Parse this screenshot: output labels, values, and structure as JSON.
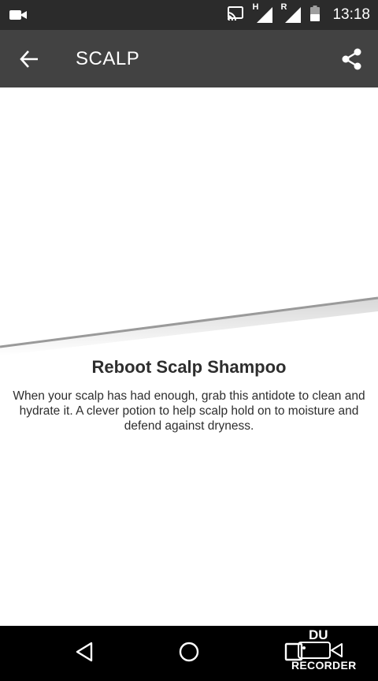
{
  "status_bar": {
    "time": "13:18",
    "network_h": "H",
    "network_r": "R"
  },
  "app_bar": {
    "title": "SCALP"
  },
  "product": {
    "name": "Reboot Scalp Shampoo",
    "description": "When your scalp has had enough, grab this antidote to clean and hydrate it. A clever potion to help scalp hold on to moisture and defend against dryness."
  },
  "watermark": {
    "top": "DU",
    "bottom": "RECORDER"
  },
  "colors": {
    "status_bar": "#2b2b2b",
    "app_bar": "#424242",
    "nav_bar": "#000000",
    "text": "#2e2e2e"
  }
}
